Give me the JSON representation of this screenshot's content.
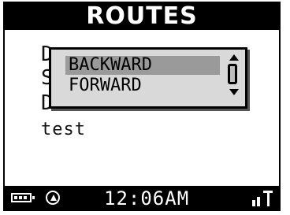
{
  "header": {
    "title": "ROUTES"
  },
  "background": {
    "row_chars": [
      "D",
      "S",
      "D"
    ],
    "text": "test"
  },
  "popup": {
    "options": [
      {
        "label": "BACKWARD",
        "selected": true
      },
      {
        "label": "FORWARD",
        "selected": false
      }
    ]
  },
  "status": {
    "time": "12:06AM",
    "icons": [
      "battery-icon",
      "navigation-icon",
      "signal-icon"
    ]
  },
  "colors": {
    "bar": "#000000",
    "selection": "#9a9a9a",
    "popup_bg": "#d9d9d9"
  }
}
